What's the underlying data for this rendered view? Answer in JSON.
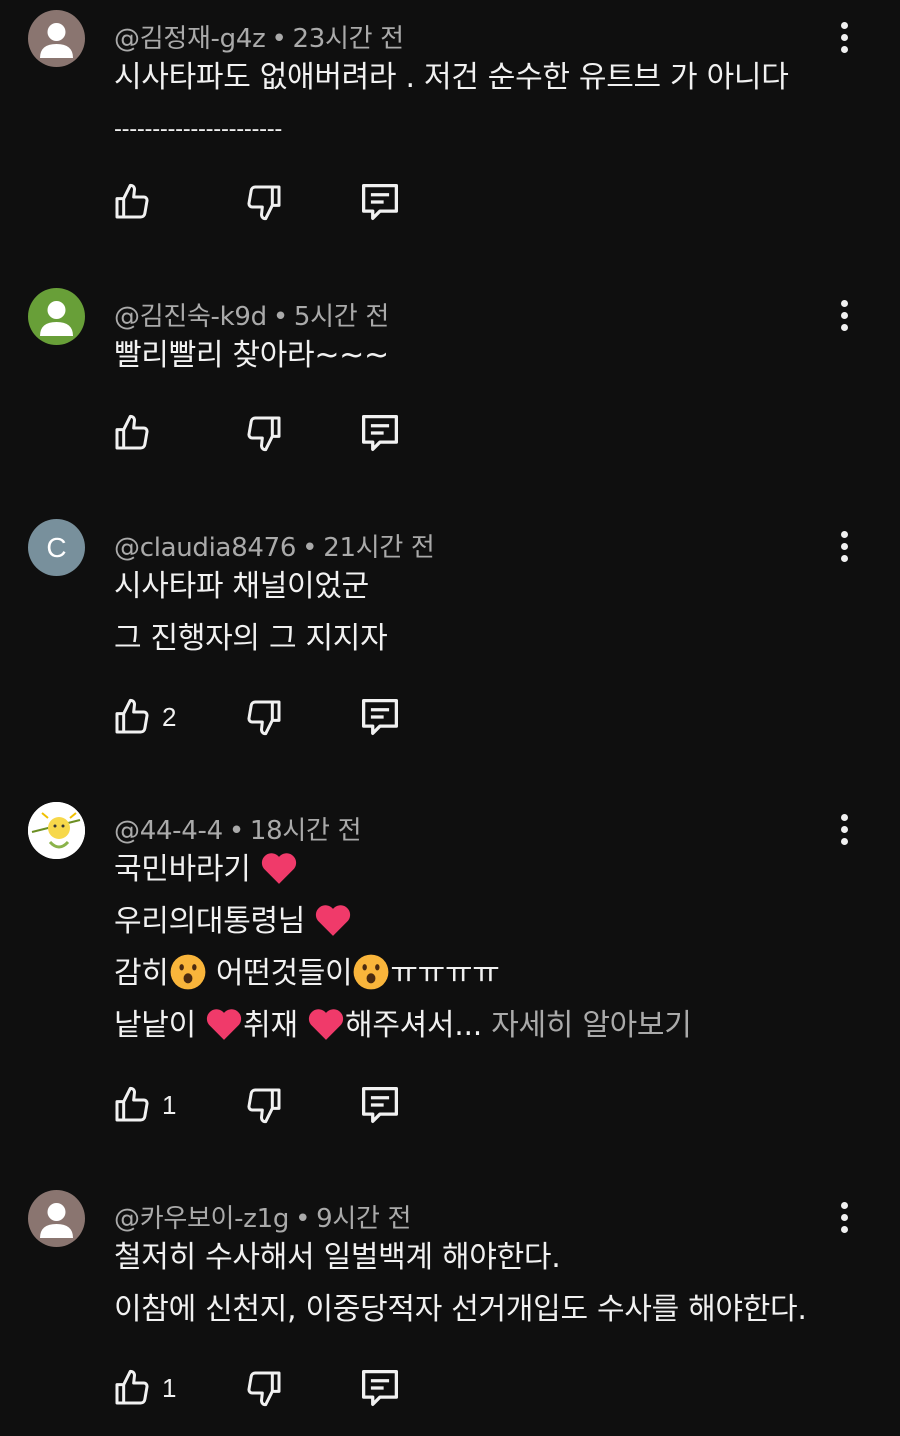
{
  "comments": [
    {
      "author": "@김정재-g4z",
      "time": "23시간 전",
      "avatar_type": "default-person",
      "lines": [
        "시사타파도 없애버려라 . 저건 순수한 유트브 가 아니다",
        "----------------------"
      ],
      "likes": ""
    },
    {
      "author": "@김진숙-k9d",
      "time": "5시간 전",
      "avatar_type": "default-person-green",
      "lines": [
        "빨리빨리 찾아라~~~"
      ],
      "likes": ""
    },
    {
      "author": "@claudia8476",
      "time": "21시간 전",
      "avatar_type": "letter",
      "avatar_letter": "C",
      "lines": [
        "시사타파 채널이었군",
        "그 진행자의 그 지지자"
      ],
      "likes": "2"
    },
    {
      "author": "@44-4-4",
      "time": "18시간 전",
      "avatar_type": "illustration",
      "lines": [
        "국민바라기",
        "우리의대통령님",
        "감히",
        "어떤것들이",
        "ㅠㅠㅠㅠ",
        "낱낱이",
        "취재",
        "해주셔서..."
      ],
      "read_more": "자세히 알아보기",
      "likes": "1"
    },
    {
      "author": "@카우보이-z1g",
      "time": "9시간 전",
      "avatar_type": "default-person",
      "lines": [
        "철저히 수사해서 일벌백계 해야한다.",
        "이참에 신천지, 이중당적자 선거개입도  수사를 해야한다."
      ],
      "likes": "1"
    }
  ],
  "meta_separator": "•",
  "icons": {
    "like": "thumbs-up-icon",
    "dislike": "thumbs-down-icon",
    "reply": "comment-icon",
    "more": "kebab-menu-icon",
    "heart": "red-heart-emoji",
    "face": "surprised-face-emoji"
  },
  "colors": {
    "background": "#0f0f0f",
    "text": "#f1f1f1",
    "secondary": "#aaaaaa"
  }
}
